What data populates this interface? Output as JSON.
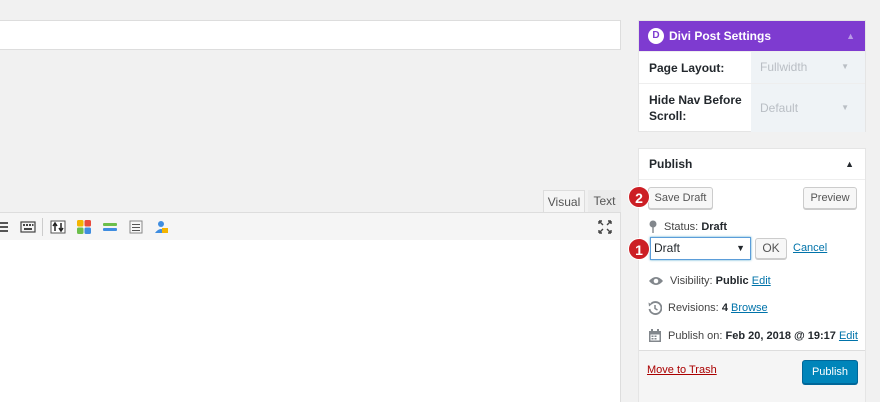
{
  "editor": {
    "tabs": [
      {
        "label": "Visual"
      },
      {
        "label": "Text"
      }
    ],
    "toolbar_icons": [
      "align-icon",
      "keyboard-icon",
      "toolbar-toggle-icon",
      "color-grid-icon",
      "divider-icon",
      "list-icon",
      "user-lock-icon"
    ],
    "fullscreen_icon": "fullscreen-icon"
  },
  "divi": {
    "title": "Divi Post Settings",
    "logo_letter": "D",
    "toggle": "▲",
    "rows": [
      {
        "label": "Page Layout:",
        "value": "Fullwidth"
      },
      {
        "label": "Hide Nav Before Scroll:",
        "value": "Default"
      }
    ],
    "accent_color": "#7e3bd0"
  },
  "publish": {
    "title": "Publish",
    "toggle": "▲",
    "save_draft": "Save Draft",
    "preview": "Preview",
    "status_label": "Status:",
    "status_value": "Draft",
    "status_select": "Draft",
    "ok": "OK",
    "cancel": "Cancel",
    "visibility_label": "Visibility:",
    "visibility_value": "Public",
    "visibility_edit": "Edit",
    "revisions_label": "Revisions:",
    "revisions_value": "4",
    "revisions_browse": "Browse",
    "publish_on_label": "Publish on:",
    "publish_on_value": "Feb 20, 2018 @ 19:17",
    "publish_on_edit": "Edit",
    "trash": "Move to Trash",
    "publish_button": "Publish",
    "button_color": "#0085ba"
  },
  "steps": [
    {
      "label": "1"
    },
    {
      "label": "2"
    }
  ]
}
